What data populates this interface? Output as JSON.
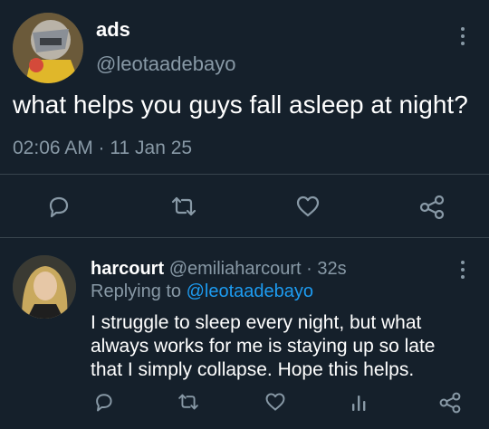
{
  "tweet": {
    "display_name": "ads",
    "handle": "@leotaadebayo",
    "text": "what helps you guys fall asleep at night?",
    "timestamp": "02:06 AM · 11 Jan 25",
    "actions": [
      "reply-icon",
      "retweet-icon",
      "like-icon",
      "share-icon"
    ]
  },
  "reply": {
    "display_name": "harcourt",
    "handle": "@emiliaharcourt",
    "time": "· 32s",
    "replying_prefix": "Replying to",
    "replying_handle": "@leotaadebayo",
    "text_lines": [
      "I struggle to sleep every night, but what",
      "always works for me is staying up so late",
      "that I simply collapse. Hope this helps."
    ],
    "actions": [
      "reply-icon",
      "retweet-icon",
      "like-icon",
      "analytics-icon",
      "share-icon"
    ]
  },
  "colors": {
    "background": "#15202b",
    "text": "#ffffff",
    "muted": "#8899a6",
    "link": "#1d9bf0",
    "divider": "#38444d"
  }
}
